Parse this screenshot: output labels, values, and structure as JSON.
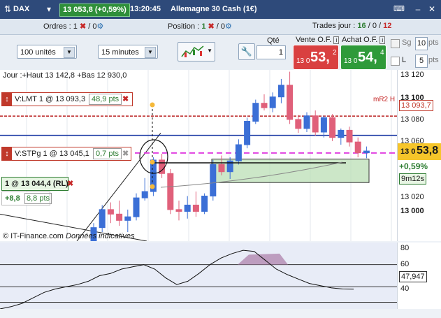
{
  "titlebar": {
    "instrument": "DAX",
    "price": "13 053,8 (+0,59%)",
    "time": "13:20:45",
    "name": "Allemagne 30 Cash (1€)"
  },
  "infobar": {
    "orders_label": "Ordres :",
    "orders_count": "1",
    "orders_zero": "0",
    "position_label": "Position :",
    "position_count": "1",
    "position_zero": "0",
    "trades_label": "Trades jour :",
    "trades_a": "16",
    "trades_b": "0",
    "trades_c": "12"
  },
  "toolbar": {
    "units": "100 unités",
    "interval": "15 minutes",
    "qty_label": "Qté",
    "qty_value": "1",
    "sell_label": "Vente O.F.",
    "sell_prefix": "13 0",
    "sell_big": "53,",
    "sell_sup": "2",
    "buy_label": "Achat O.F.",
    "buy_prefix": "13 0",
    "buy_big": "54,",
    "buy_sup": "4",
    "sg_label": "Sg",
    "sg_value": "10",
    "sg_unit": "pts",
    "l_label": "L",
    "l_value": "5",
    "l_unit": "pts"
  },
  "chart": {
    "info": "Jour :+Haut 13 142,8 +Bas 12 930,0",
    "watermark_brand": "© IT-Finance.com",
    "watermark_note": "Données indicatives",
    "lmt_order": "V:LMT  1 @ 13 093,3",
    "lmt_pts": "48,9 pts",
    "stp_order": "V:STPg  1 @ 13 045,1",
    "stp_pts": "0,7 pts",
    "position": "1 @ 13 044,4 (RL)",
    "pos_pts_a": "+8,8",
    "pos_pts_b": "8,8 pts",
    "mr2_label": "mR2 H",
    "yticks": [
      "13 120",
      "13 100",
      "13 080",
      "13 060",
      "13 020",
      "13 000"
    ],
    "lmt_tag": "13 093,7",
    "price_tag_small": "13 0",
    "price_tag_big": "53,8",
    "pct_tag": "+0,59%",
    "timer_tag": "9m12s"
  },
  "oscillator": {
    "yticks": [
      "80",
      "60",
      "40"
    ],
    "value_tag": "47,947"
  },
  "chart_data": {
    "type": "candlestick",
    "candles": [
      {
        "o": 12955,
        "h": 12975,
        "l": 12940,
        "c": 12970
      },
      {
        "o": 12970,
        "h": 12995,
        "l": 12965,
        "c": 12990
      },
      {
        "o": 12990,
        "h": 12998,
        "l": 12975,
        "c": 12985
      },
      {
        "o": 12985,
        "h": 13000,
        "l": 12972,
        "c": 12978
      },
      {
        "o": 12978,
        "h": 12990,
        "l": 12965,
        "c": 12982
      },
      {
        "o": 12982,
        "h": 13008,
        "l": 12978,
        "c": 13003
      },
      {
        "o": 13003,
        "h": 13025,
        "l": 13000,
        "c": 13010
      },
      {
        "o": 13010,
        "h": 13048,
        "l": 13005,
        "c": 13045
      },
      {
        "o": 13045,
        "h": 13052,
        "l": 13025,
        "c": 13030
      },
      {
        "o": 13030,
        "h": 13035,
        "l": 12985,
        "c": 12990
      },
      {
        "o": 12990,
        "h": 13000,
        "l": 12978,
        "c": 12988
      },
      {
        "o": 12988,
        "h": 13005,
        "l": 12980,
        "c": 12995
      },
      {
        "o": 12995,
        "h": 13010,
        "l": 12982,
        "c": 12988
      },
      {
        "o": 12988,
        "h": 13008,
        "l": 12985,
        "c": 13005
      },
      {
        "o": 13005,
        "h": 13045,
        "l": 13000,
        "c": 13040
      },
      {
        "o": 13040,
        "h": 13050,
        "l": 13028,
        "c": 13032
      },
      {
        "o": 13032,
        "h": 13048,
        "l": 13024,
        "c": 13044
      },
      {
        "o": 13044,
        "h": 13068,
        "l": 13040,
        "c": 13062
      },
      {
        "o": 13062,
        "h": 13092,
        "l": 13058,
        "c": 13088
      },
      {
        "o": 13088,
        "h": 13112,
        "l": 13085,
        "c": 13108
      },
      {
        "o": 13108,
        "h": 13118,
        "l": 13100,
        "c": 13103
      },
      {
        "o": 13103,
        "h": 13120,
        "l": 13098,
        "c": 13115
      },
      {
        "o": 13115,
        "h": 13135,
        "l": 13108,
        "c": 13128
      },
      {
        "o": 13128,
        "h": 13143,
        "l": 13085,
        "c": 13090
      },
      {
        "o": 13090,
        "h": 13095,
        "l": 13075,
        "c": 13080
      },
      {
        "o": 13080,
        "h": 13098,
        "l": 13076,
        "c": 13094
      },
      {
        "o": 13094,
        "h": 13100,
        "l": 13072,
        "c": 13076
      },
      {
        "o": 13076,
        "h": 13094,
        "l": 13070,
        "c": 13092
      },
      {
        "o": 13092,
        "h": 13096,
        "l": 13066,
        "c": 13070
      },
      {
        "o": 13070,
        "h": 13080,
        "l": 13062,
        "c": 13078
      },
      {
        "o": 13078,
        "h": 13082,
        "l": 13060,
        "c": 13065
      },
      {
        "o": 13065,
        "h": 13070,
        "l": 13048,
        "c": 13053
      },
      {
        "o": 13053,
        "h": 13060,
        "l": 13047,
        "c": 13055
      }
    ],
    "levels": {
      "mr2": 13093.7,
      "stop": 13045.1,
      "price": 13053.8
    },
    "ylim": [
      12955,
      13145
    ],
    "oscillator": [
      30,
      32,
      35,
      40,
      45,
      48,
      50,
      52,
      55,
      60,
      62,
      66,
      68,
      70,
      66,
      58,
      52,
      55,
      62,
      70,
      76,
      80,
      83,
      82,
      74,
      66,
      61,
      57,
      53,
      51,
      49,
      48,
      47.9
    ],
    "osc_ylim": [
      30,
      90
    ]
  }
}
